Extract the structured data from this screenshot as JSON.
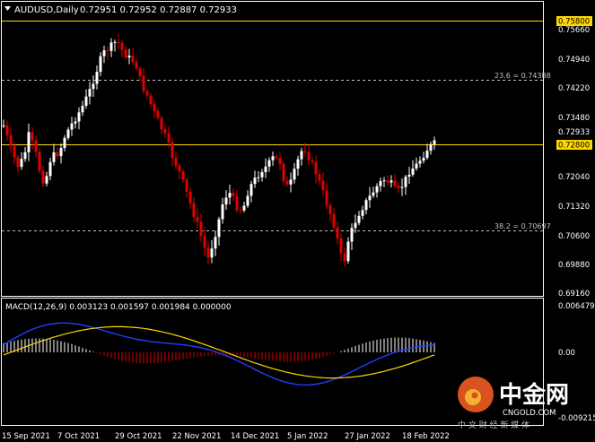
{
  "header": {
    "symbol": "AUDUSD,Daily",
    "ohlc": "0.72951 0.72952 0.72887 0.72933"
  },
  "macd": {
    "label": "MACD(12,26,9) 0.003123 0.001597 0.001984 0.000000"
  },
  "price_axis": {
    "ticks": [
      "0.75660",
      "0.74940",
      "0.74220",
      "0.73480",
      "0.72040",
      "0.71320",
      "0.70600",
      "0.69880",
      "0.69160"
    ],
    "current_price": "0.72933"
  },
  "macd_axis": {
    "ticks": [
      "0.006479",
      "0.00",
      "-0.009215"
    ]
  },
  "levels": [
    {
      "label": "0.75800",
      "kind": "solid",
      "color": "#ffd700"
    },
    {
      "label": "23.6 = 0.74388",
      "kind": "dashed",
      "color": "#c0c0c0"
    },
    {
      "label": "0.72800",
      "kind": "solid",
      "color": "#ffd700"
    },
    {
      "label": "38.2 = 0.70697",
      "kind": "dashed",
      "color": "#c0c0c0"
    }
  ],
  "time_axis": {
    "labels": [
      "15 Sep 2021",
      "7 Oct 2021",
      "29 Oct 2021",
      "22 Nov 2021",
      "14 Dec 2021",
      "5 Jan 2022",
      "27 Jan 2022",
      "18 Feb 2022"
    ]
  },
  "watermark": {
    "brand_cn": "中金网",
    "brand_en": "CNGOLD.COM",
    "slogan": "中 文 财 经 新 媒 体"
  },
  "colors": {
    "bull": "#ffffff",
    "bear": "#e00000",
    "macd_line": "#1f3fff",
    "signal_line": "#ffd700",
    "level_line": "#ffd700",
    "grid_dash": "#c0c0c0",
    "frame": "#ffffff"
  }
}
